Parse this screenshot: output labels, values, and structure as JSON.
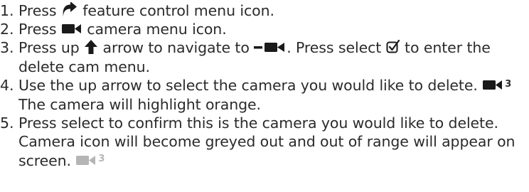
{
  "steps": [
    {
      "number": "1.",
      "text_a": "Press",
      "icon": "feature-control-arrow-icon",
      "text_b": "feature control menu icon."
    },
    {
      "number": "2.",
      "text_a": "Press",
      "icon": "camera-icon",
      "text_b": "camera menu icon."
    },
    {
      "number": "3.",
      "text_a": "Press up",
      "icon_a": "up-arrow-icon",
      "text_b": "arrow to navigate to",
      "icon_b": "delete-camera-icon",
      "text_c": ".  Press select",
      "icon_c": "select-checkbox-icon",
      "text_d": "to enter the delete cam menu."
    },
    {
      "number": "4.",
      "text_a": "Use the up arrow to select the camera you would like to delete.",
      "icon": "camera-icon",
      "camera_number": "3",
      "text_b": "The camera will highlight orange."
    },
    {
      "number": "5.",
      "text_a": "Press select to confirm this is the camera you would like to delete.  Camera icon will become greyed out and out of range will appear on screen.",
      "icon": "camera-greyed-icon",
      "camera_number": "3"
    }
  ],
  "colors": {
    "text": "#2b2b2b",
    "icon": "#1a1a1a",
    "greyed_icon": "#b5b5b5"
  }
}
